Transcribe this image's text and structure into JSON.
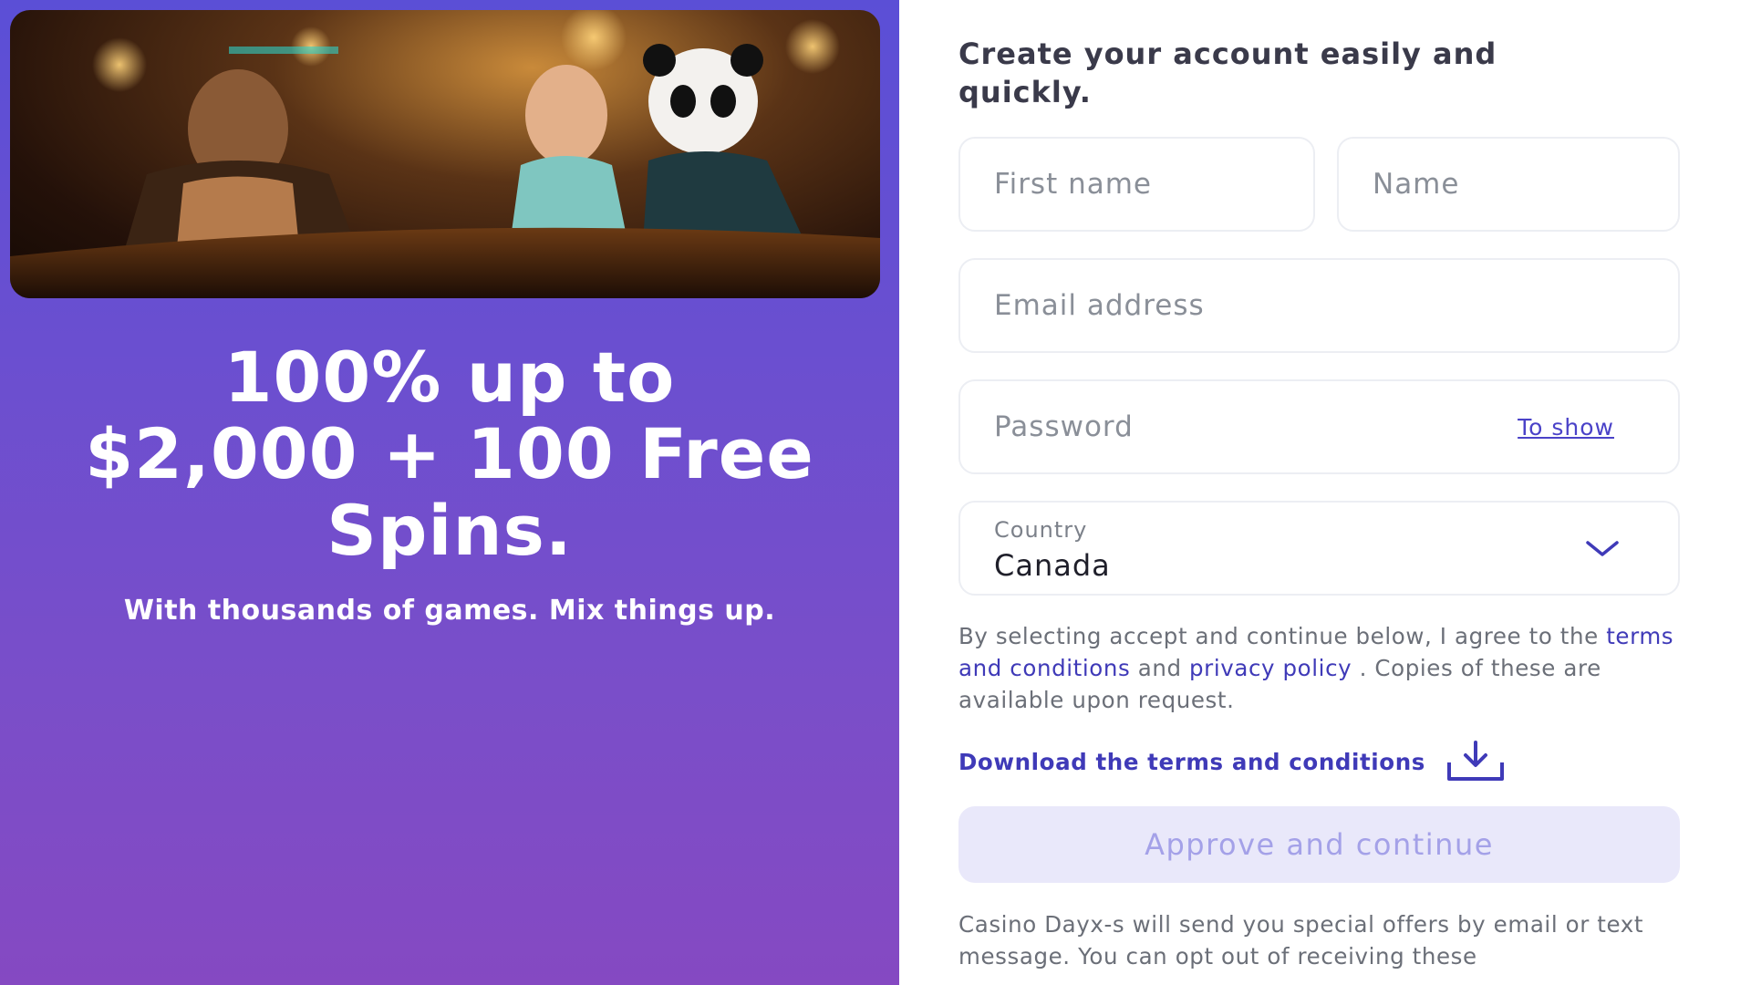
{
  "promo": {
    "headline_line1": "100% up to",
    "headline_line2": "$2,000 + 100 Free",
    "headline_line3": "Spins.",
    "subline": "With thousands of games. Mix things up."
  },
  "form": {
    "title": "Create your account easily and quickly.",
    "first_name_placeholder": "First name",
    "name_placeholder": "Name",
    "email_placeholder": "Email address",
    "password_placeholder": "Password",
    "show_password_label": "To show",
    "country_label": "Country",
    "country_value": "Canada",
    "legal_prefix": "By selecting accept and continue below, I agree to the",
    "terms_link": "terms and conditions",
    "legal_and": "and",
    "privacy_link": "privacy policy",
    "legal_suffix": ". Copies of these are available upon request.",
    "download_label": "Download the terms and conditions",
    "approve_label": "Approve and continue",
    "footer_note": "Casino Dayx-s will send you special offers by email or text message. You can opt out of receiving these"
  },
  "colors": {
    "accent": "#3f3ab8",
    "promo_top": "#5b4fd6",
    "promo_bottom": "#8549c2",
    "button_bg": "#e9e8fa",
    "button_text": "#a4a1e8"
  },
  "icons": {
    "chevron": "chevron-down-icon",
    "download": "download-icon"
  }
}
